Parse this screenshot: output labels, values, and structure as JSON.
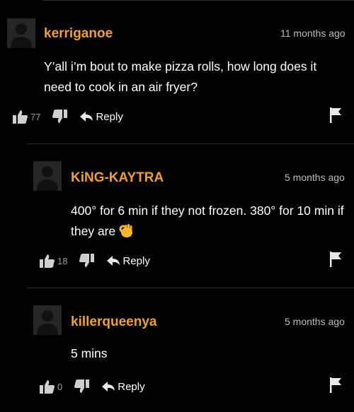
{
  "comments": [
    {
      "username": "kerriganoe",
      "timestamp": "11 months ago",
      "text": "Y’all i’m bout to make pizza rolls, how long does it need to cook in an air fryer?",
      "likes": "77",
      "reply_label": "Reply",
      "icons": [
        "thumbs-up-icon",
        "thumbs-down-icon",
        "reply-arrow-icon",
        "flag-icon"
      ]
    },
    {
      "username": "KiNG-KAYTRA",
      "timestamp": "5 months ago",
      "text": "400° for 6 min if they not frozen. 380° for 10 min if they are",
      "emoji": "ok-hand-emoji",
      "likes": "18",
      "reply_label": "Reply",
      "icons": [
        "thumbs-up-icon",
        "thumbs-down-icon",
        "reply-arrow-icon",
        "flag-icon"
      ]
    },
    {
      "username": "killerqueenya",
      "timestamp": "5 months ago",
      "text": "5 mins",
      "likes": "0",
      "reply_label": "Reply",
      "icons": [
        "thumbs-up-icon",
        "thumbs-down-icon",
        "reply-arrow-icon",
        "flag-icon"
      ]
    }
  ],
  "colors": {
    "username": "#f0a030",
    "background": "#000000",
    "count": "#9a9a9a"
  }
}
